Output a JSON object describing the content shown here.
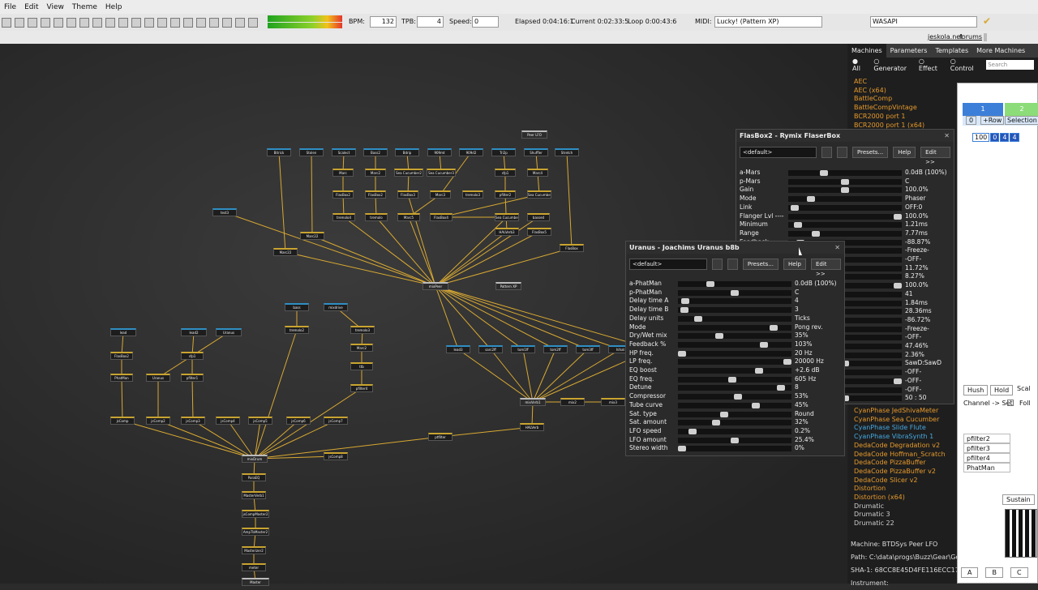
{
  "menu": [
    "File",
    "Edit",
    "View",
    "Theme",
    "Help"
  ],
  "toolbar": {
    "bpm_label": "BPM:",
    "bpm": "132",
    "tpb_label": "TPB:",
    "tpb": "4",
    "speed_label": "Speed:",
    "speed": "0",
    "elapsed": "Elapsed 0:04:16:1",
    "current": "Current 0:02:33:5",
    "loop": "Loop 0:00:43:6",
    "midi_label": "MIDI:",
    "midi": "Lucky! (Pattern XP)",
    "audio": "WASAPI"
  },
  "links": {
    "site": "jeskola.net",
    "forums": "forums"
  },
  "machines": [
    {
      "label": "Peer LFO",
      "type": "master"
    },
    {
      "label": "Bitrick",
      "type": "gen"
    },
    {
      "label": "Stolen",
      "type": "gen"
    },
    {
      "label": "Scalect",
      "type": "gen"
    },
    {
      "label": "Bass2",
      "type": "gen"
    },
    {
      "label": "Bdrip",
      "type": "gen"
    },
    {
      "label": "909mt",
      "type": "gen"
    },
    {
      "label": "909d2",
      "type": "gen"
    },
    {
      "label": "Tri2p",
      "type": "gen"
    },
    {
      "label": "Shuffler",
      "type": "gen"
    },
    {
      "label": "Stretch",
      "type": "gen"
    },
    {
      "label": "Marc",
      "type": "eff"
    },
    {
      "label": "Marc2",
      "type": "eff"
    },
    {
      "label": "Sea Cucumber2",
      "type": "eff"
    },
    {
      "label": "Sea Cucumber3",
      "type": "eff"
    },
    {
      "label": "sfp1",
      "type": "eff"
    },
    {
      "label": "Marc4",
      "type": "eff"
    },
    {
      "label": "FlasBox2",
      "type": "eff"
    },
    {
      "label": "FlasBox2",
      "type": "eff"
    },
    {
      "label": "FlasBox3",
      "type": "eff"
    },
    {
      "label": "Marc3",
      "type": "eff"
    },
    {
      "label": "tremolo3",
      "type": "eff"
    },
    {
      "label": "pfilter2",
      "type": "eff"
    },
    {
      "label": "Sea Cucumber",
      "type": "eff"
    },
    {
      "label": "tremolo4",
      "type": "eff"
    },
    {
      "label": "tremolo",
      "type": "eff"
    },
    {
      "label": "Marc5",
      "type": "eff"
    },
    {
      "label": "FlasBox4",
      "type": "eff"
    },
    {
      "label": "Sea Cucumber4",
      "type": "eff"
    },
    {
      "label": "bassed",
      "type": "eff"
    },
    {
      "label": "Marc22",
      "type": "eff"
    },
    {
      "label": "HALVerb3",
      "type": "eff"
    },
    {
      "label": "FlasBox5",
      "type": "eff"
    },
    {
      "label": "test3",
      "type": "gen"
    },
    {
      "label": "Marc22",
      "type": "eff"
    },
    {
      "label": "FlasBox",
      "type": "eff"
    },
    {
      "label": "mixPeer",
      "type": "master"
    },
    {
      "label": "Pattern XP",
      "type": "master"
    },
    {
      "label": "bass",
      "type": "gen"
    },
    {
      "label": "mixdrive",
      "type": "gen"
    },
    {
      "label": "tremolo2",
      "type": "eff"
    },
    {
      "label": "tremolo3",
      "type": "eff"
    },
    {
      "label": "Marc2",
      "type": "eff"
    },
    {
      "label": "ttb",
      "type": "eff"
    },
    {
      "label": "pfilter4",
      "type": "eff"
    },
    {
      "label": "lead",
      "type": "gen"
    },
    {
      "label": "lead2",
      "type": "gen"
    },
    {
      "label": "Uranus",
      "type": "gen"
    },
    {
      "label": "FlasBox2",
      "type": "eff"
    },
    {
      "label": "sfp1",
      "type": "eff"
    },
    {
      "label": "PhatMan",
      "type": "eff"
    },
    {
      "label": "pfilter1",
      "type": "eff"
    },
    {
      "label": "Uranus",
      "type": "eff"
    },
    {
      "label": "jsComp",
      "type": "eff"
    },
    {
      "label": "jsComp2",
      "type": "eff"
    },
    {
      "label": "jsComp3",
      "type": "eff"
    },
    {
      "label": "jsComp4",
      "type": "eff"
    },
    {
      "label": "jsComp5",
      "type": "eff"
    },
    {
      "label": "jsComp6",
      "type": "eff"
    },
    {
      "label": "jsComp7",
      "type": "eff"
    },
    {
      "label": "mixDrum",
      "type": "master"
    },
    {
      "label": "jsComp8",
      "type": "eff"
    },
    {
      "label": "ptfilter",
      "type": "eff"
    },
    {
      "label": "ParaEQ",
      "type": "eff"
    },
    {
      "label": "MasterVerb1",
      "type": "eff"
    },
    {
      "label": "jsCompMaster2",
      "type": "eff"
    },
    {
      "label": "AmpTbMaster2",
      "type": "eff"
    },
    {
      "label": "Masterizer2",
      "type": "eff"
    },
    {
      "label": "meter",
      "type": "eff"
    },
    {
      "label": "Master",
      "type": "master"
    },
    {
      "label": "lead3",
      "type": "gen"
    },
    {
      "label": "sarc2ff",
      "type": "gen"
    },
    {
      "label": "tom1ff",
      "type": "gen"
    },
    {
      "label": "tom2ff",
      "type": "gen"
    },
    {
      "label": "tom3ff",
      "type": "gen"
    },
    {
      "label": "hihat",
      "type": "gen"
    },
    {
      "label": "hh2ff",
      "type": "gen"
    },
    {
      "label": "mixVerb1",
      "type": "master"
    },
    {
      "label": "HALVerb",
      "type": "eff"
    },
    {
      "label": "mix2",
      "type": "eff"
    },
    {
      "label": "mix3",
      "type": "eff"
    }
  ],
  "right_panel": {
    "tabs": [
      "Machines",
      "Parameters",
      "Templates",
      "More Machines"
    ],
    "filters": [
      "All",
      "Generator",
      "Effect",
      "Control"
    ],
    "search_placeholder": "Search",
    "list_top": [
      "AEC",
      "AEC (x64)",
      "BattleComp",
      "BattleCompVintage",
      "BCR2000 port 1",
      "BCR2000 port 1 (x64)"
    ],
    "list_bottom": [
      {
        "name": "CyanPhase JedShivaMeter",
        "color": "#e69a2d"
      },
      {
        "name": "CyanPhase Sea Cucumber",
        "color": "#e69a2d"
      },
      {
        "name": "CyanPhase Slide Flute",
        "color": "#45a8e0"
      },
      {
        "name": "CyanPhase VibraSynth 1",
        "color": "#45a8e0"
      },
      {
        "name": "DedaCode Degradation v2",
        "color": "#e69a2d"
      },
      {
        "name": "DedaCode Hoffman_Scratch",
        "color": "#e69a2d"
      },
      {
        "name": "DedaCode PizzaBuffer",
        "color": "#e69a2d"
      },
      {
        "name": "DedaCode PizzaBuffer v2",
        "color": "#e69a2d"
      },
      {
        "name": "DedaCode Slicer v2",
        "color": "#e69a2d"
      },
      {
        "name": "Distortion",
        "color": "#e69a2d"
      },
      {
        "name": "Distortion (x64)",
        "color": "#e69a2d"
      },
      {
        "name": "Drumatic",
        "color": "#cccccc"
      },
      {
        "name": "Drumatic 3",
        "color": "#cccccc"
      },
      {
        "name": "Drumatic 22",
        "color": "#cccccc"
      }
    ],
    "machine": "Machine:  BTDSys Peer LFO",
    "path": "Path:  C:\\data\\progs\\Buzz\\Gear\\Generators\\",
    "sha": "SHA-1:  68CC8E45D4FE116ECC176D",
    "instrument": "Instrument:"
  },
  "flasbox": {
    "title": "FlasBox2 - Rymix FlaserBox",
    "preset": "<default>",
    "presets_btn": "Presets...",
    "help_btn": "Help",
    "edit_btn": "Edit >>",
    "params": [
      {
        "name": "a-Mars",
        "value": "0.0dB (100%)",
        "level": 0.3
      },
      {
        "name": "p-Mars",
        "value": "C",
        "level": 0.5
      },
      {
        "name": "Gain",
        "value": "100.0%",
        "level": 0.5
      },
      {
        "name": "Mode",
        "value": "Phaser",
        "level": 0.18
      },
      {
        "name": "Link",
        "value": "OFF:0",
        "level": 0.02
      },
      {
        "name": "Flanger Lvl ----",
        "value": "100.0%",
        "level": 1.0
      },
      {
        "name": "Minimum",
        "value": "1.21ms",
        "level": 0.05
      },
      {
        "name": "Range",
        "value": "7.77ms",
        "level": 0.22
      },
      {
        "name": "Feedback",
        "value": "-88.87%",
        "level": 0.08
      },
      {
        "name": "",
        "value": "-Freeze-",
        "level": 0.0
      },
      {
        "name": "",
        "value": "-OFF-",
        "level": 0.0
      },
      {
        "name": "",
        "value": "11.72%",
        "level": 0.4
      },
      {
        "name": "",
        "value": "8.27%",
        "level": 0.3
      },
      {
        "name": "",
        "value": "100.0%",
        "level": 1.0
      },
      {
        "name": "",
        "value": "41",
        "level": 0.3
      },
      {
        "name": "",
        "value": "1.84ms",
        "level": 0.05
      },
      {
        "name": "",
        "value": "28.36ms",
        "level": 0.4
      },
      {
        "name": "",
        "value": "-86.72%",
        "level": 0.1
      },
      {
        "name": "",
        "value": "-Freeze-",
        "level": 0.0
      },
      {
        "name": "",
        "value": "-OFF-",
        "level": 0.0
      },
      {
        "name": "",
        "value": "47.46%",
        "level": 0.45
      },
      {
        "name": "",
        "value": "2.36%",
        "level": 0.05
      },
      {
        "name": "",
        "value": "SawD:SawD",
        "level": 0.5
      },
      {
        "name": "",
        "value": "-OFF-",
        "level": 0.0
      },
      {
        "name": "",
        "value": "-OFF-",
        "level": 1.0
      },
      {
        "name": "",
        "value": "-OFF-",
        "level": 0.0
      },
      {
        "name": "",
        "value": "50 : 50",
        "level": 0.5
      }
    ]
  },
  "uranus": {
    "title": "Uranus - Joachims Uranus b8b",
    "preset": "<default>",
    "presets_btn": "Presets...",
    "help_btn": "Help",
    "edit_btn": "Edit >>",
    "params": [
      {
        "name": "a-PhatMan",
        "value": "0.0dB (100%)",
        "level": 0.27
      },
      {
        "name": "p-PhatMan",
        "value": "C",
        "level": 0.5
      },
      {
        "name": "Delay time A",
        "value": "4",
        "level": 0.03
      },
      {
        "name": "Delay time B",
        "value": "3",
        "level": 0.02
      },
      {
        "name": "Delay units",
        "value": "Ticks",
        "level": 0.15
      },
      {
        "name": "Mode",
        "value": "Pong rev.",
        "level": 0.87
      },
      {
        "name": "Dry/Wet mix",
        "value": "35%",
        "level": 0.35
      },
      {
        "name": "Feedback %",
        "value": "103%",
        "level": 0.78
      },
      {
        "name": "HP freq.",
        "value": "20 Hz",
        "level": 0.0
      },
      {
        "name": "LP freq.",
        "value": "20000 Hz",
        "level": 1.0
      },
      {
        "name": "EQ boost",
        "value": "+2.6 dB",
        "level": 0.73
      },
      {
        "name": "EQ freq.",
        "value": "605 Hz",
        "level": 0.48
      },
      {
        "name": "Detune",
        "value": "8",
        "level": 0.94
      },
      {
        "name": "Compressor",
        "value": "53%",
        "level": 0.53
      },
      {
        "name": "Tube curve",
        "value": "45%",
        "level": 0.7
      },
      {
        "name": "Sat. type",
        "value": "Round",
        "level": 0.4
      },
      {
        "name": "Sat. amount",
        "value": "32%",
        "level": 0.32
      },
      {
        "name": "LFO speed",
        "value": "0.2%",
        "level": 0.1
      },
      {
        "name": "LFO amount",
        "value": "25.4%",
        "level": 0.5
      },
      {
        "name": "Stereo width",
        "value": "0%",
        "level": 0.0
      }
    ]
  },
  "pattern": {
    "tab1": "1",
    "tab2": "2",
    "zero": "0",
    "row_btn": "+Row",
    "selection": "Selection",
    "nums": [
      "100",
      "0",
      "4",
      "4"
    ],
    "hush": "Hush",
    "hold": "Hold",
    "scale": "Scal",
    "channel": "Channel -> Set",
    "follow": "Foll",
    "list": [
      "pfilter2",
      "pfilter3",
      "pfilter4",
      "PhatMan"
    ],
    "sustain": "Sustain",
    "keys": [
      "A",
      "B",
      "C"
    ]
  },
  "colors": {
    "accent": "#d9a932",
    "generator": "#2f8fc4",
    "effect": "#c9a430",
    "toolbar_accept": "#d9a932"
  }
}
